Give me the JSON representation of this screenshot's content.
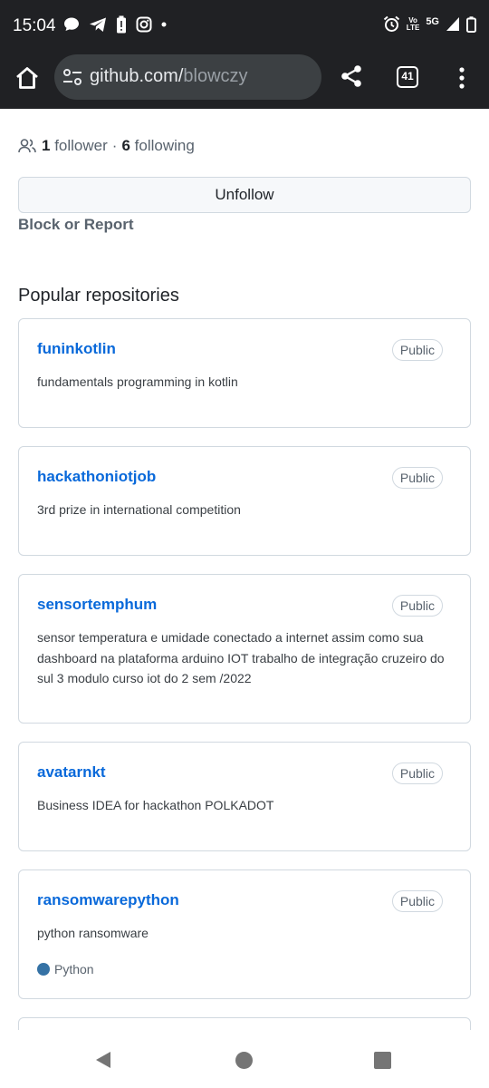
{
  "status_bar": {
    "time": "15:04",
    "left_icons": [
      "chat-bubble-icon",
      "telegram-icon",
      "battery-alert-icon",
      "instagram-icon",
      "dot-icon"
    ],
    "right_icons": [
      "alarm-icon",
      "volte-icon",
      "signal-5g-icon",
      "battery-icon"
    ],
    "volte_top": "Vo",
    "volte_bottom": "LTE",
    "network": "5G"
  },
  "browser": {
    "url_host": "github.com/",
    "url_path": "blowczy",
    "tab_count": "41"
  },
  "profile": {
    "followers_count": "1",
    "followers_label": "follower",
    "separator": "·",
    "following_count": "6",
    "following_label": "following",
    "unfollow_label": "Unfollow",
    "block_label": "Block or Report"
  },
  "section_title": "Popular repositories",
  "repositories": [
    {
      "name": "funinkotlin",
      "visibility": "Public",
      "description": "fundamentals programming in kotlin",
      "language": ""
    },
    {
      "name": "hackathoniotjob",
      "visibility": "Public",
      "description": "3rd prize in international competition",
      "language": ""
    },
    {
      "name": "sensortemphum",
      "visibility": "Public",
      "description": "sensor temperatura e umidade conectado a internet assim como sua dashboard na plataforma arduino IOT trabalho de integração cruzeiro do sul 3 modulo curso iot do 2 sem /2022",
      "language": ""
    },
    {
      "name": "avatarnkt",
      "visibility": "Public",
      "description": "Business IDEA for hackathon POLKADOT",
      "language": ""
    },
    {
      "name": "ransomwarepython",
      "visibility": "Public",
      "description": "python ransomware",
      "language": "Python"
    }
  ],
  "colors": {
    "link": "#0969da",
    "python": "#3572A5",
    "chrome_bg": "#202124"
  }
}
